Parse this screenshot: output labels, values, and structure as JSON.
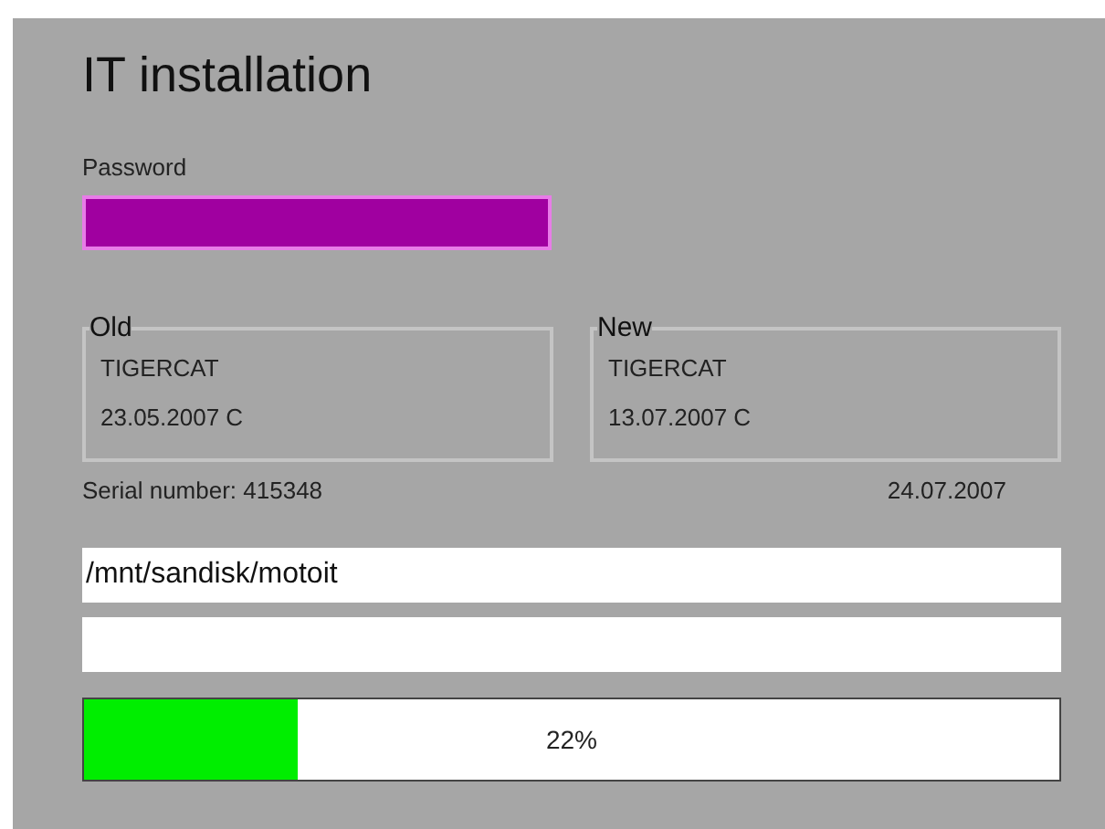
{
  "title": "IT installation",
  "password": {
    "label": "Password"
  },
  "versions": [
    {
      "legend": "Old",
      "name": "TIGERCAT",
      "date": "23.05.2007 C"
    },
    {
      "legend": "New",
      "name": "TIGERCAT",
      "date": "13.07.2007 C"
    }
  ],
  "serial": "Serial number: 415348",
  "date": "24.07.2007",
  "path": {
    "value": "/mnt/sandisk/motoit"
  },
  "progress": {
    "level": 0.22,
    "reading": "22%"
  }
}
